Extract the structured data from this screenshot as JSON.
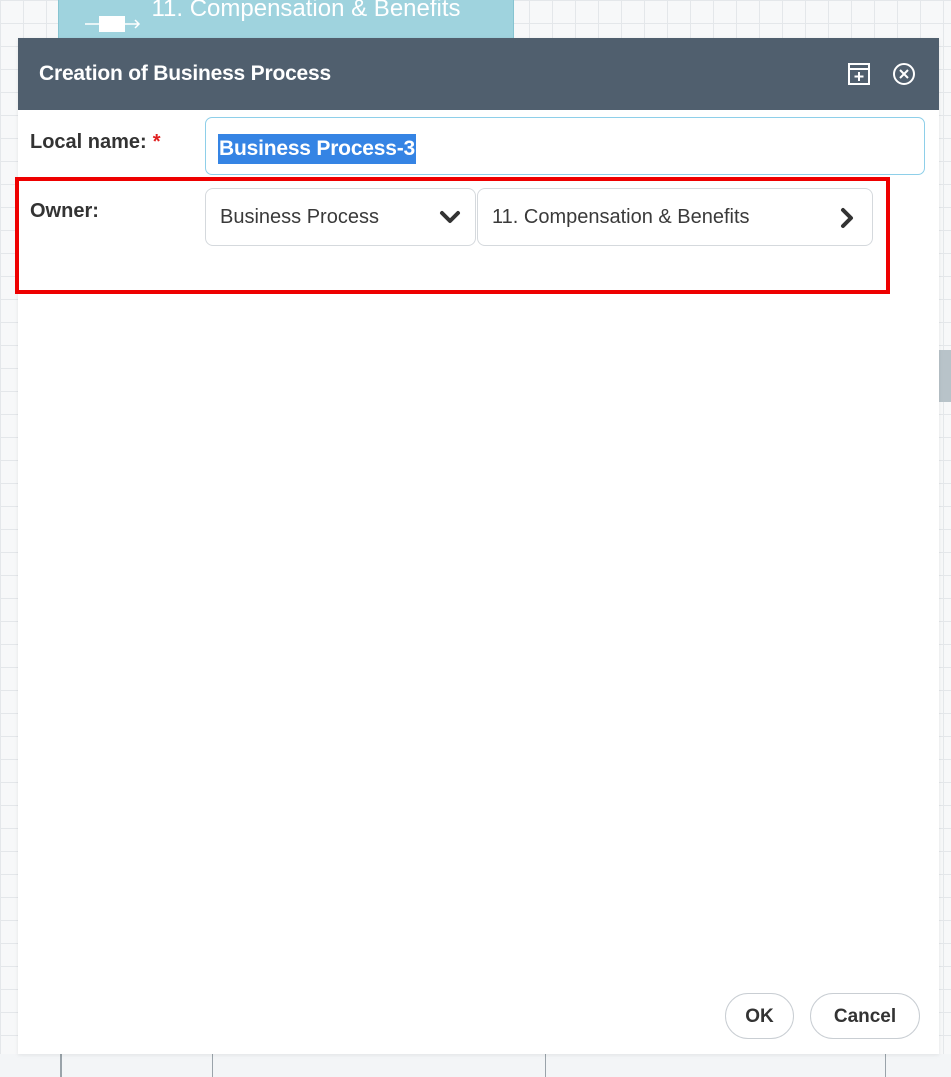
{
  "background": {
    "node_label": "11. Compensation & Benefits"
  },
  "dialog": {
    "title": "Creation of Business Process",
    "header_icons": [
      "expand-icon",
      "close-circle-icon"
    ],
    "local_name": {
      "label": "Local name:",
      "required_marker": "*",
      "value": "Business Process-3"
    },
    "owner": {
      "label": "Owner:",
      "type_select": "Business Process",
      "path_value": "11. Compensation & Benefits"
    },
    "buttons": {
      "ok": "OK",
      "cancel": "Cancel"
    }
  },
  "colors": {
    "header": "#505f6e",
    "selection": "#3584e4",
    "highlight": "#ee0000",
    "required": "#e02020"
  }
}
